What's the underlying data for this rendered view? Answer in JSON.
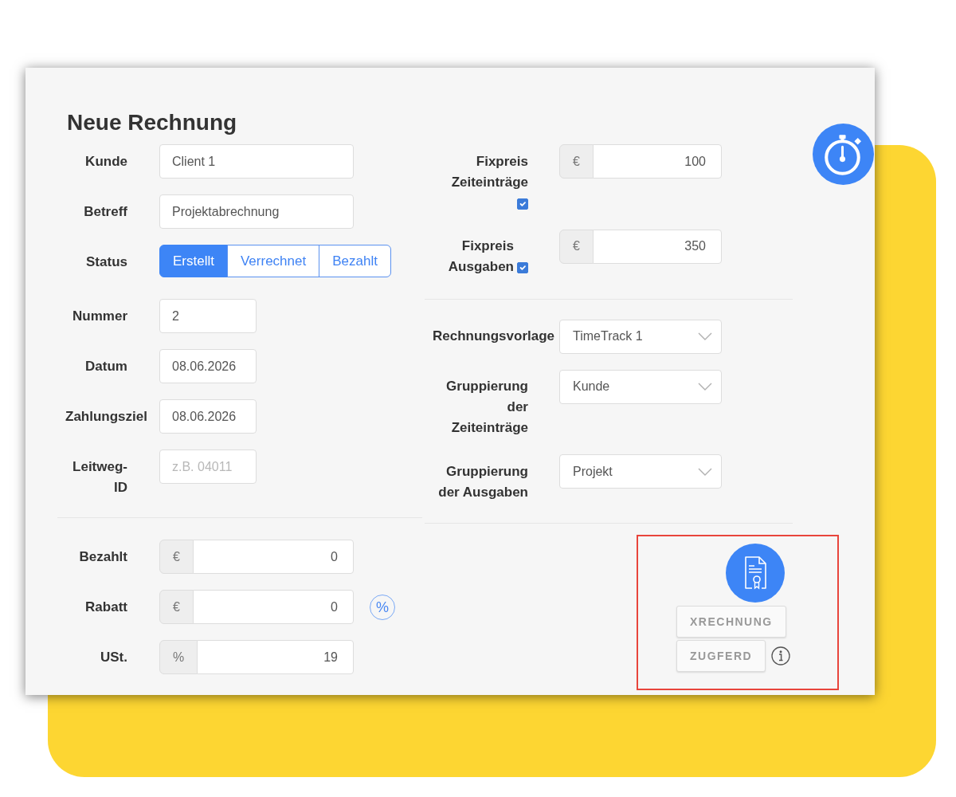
{
  "title": "Neue Rechnung",
  "invoice_fields": [
    {
      "kind": "text",
      "label": "Kunde",
      "value": "Client 1"
    },
    {
      "kind": "text",
      "label": "Betreff",
      "value": "Projektabrechnung"
    },
    {
      "kind": "status",
      "label": "Status",
      "options": [
        {
          "label": "Erstellt",
          "selected": true
        },
        {
          "label": "Verrechnet",
          "selected": false
        },
        {
          "label": "Bezahlt",
          "selected": false
        }
      ]
    },
    {
      "kind": "short",
      "label": "Nummer",
      "value": "2"
    },
    {
      "kind": "short",
      "label": "Datum",
      "value": "08.06.2026"
    },
    {
      "kind": "short",
      "label": "Zahlungsziel",
      "value": "08.06.2026"
    },
    {
      "kind": "short",
      "label": "Leitweg-ID",
      "placeholder": "z.B. 04011"
    }
  ],
  "amount_fields": [
    {
      "label": "Bezahlt",
      "prefix": "€",
      "value": "0"
    },
    {
      "label": "Rabatt",
      "prefix": "€",
      "value": "0",
      "toggle": "%"
    },
    {
      "label": "USt.",
      "prefix": "%",
      "value": "19"
    }
  ],
  "fixed_prices": [
    {
      "label": "Fixpreis Zeiteinträge",
      "checked": true,
      "prefix": "€",
      "value": "100"
    },
    {
      "label": "Fixpreis Ausgaben",
      "checked": true,
      "prefix": "€",
      "value": "350"
    }
  ],
  "template_settings": [
    {
      "label": "Rechnungsvorlage",
      "value": "TimeTrack 1"
    },
    {
      "label": "Gruppierung der Zeiteinträge",
      "value": "Kunde"
    },
    {
      "label": "Gruppierung der Ausgaben",
      "value": "Projekt"
    }
  ],
  "e_invoice": {
    "buttons": [
      {
        "label": "XRECHNUNG",
        "info": false
      },
      {
        "label": "ZUGFERD",
        "info": true
      }
    ]
  }
}
